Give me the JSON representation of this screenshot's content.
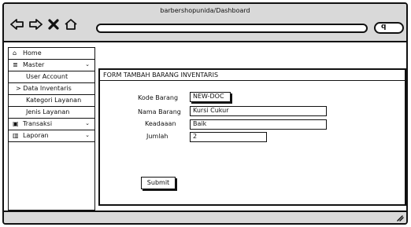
{
  "window": {
    "title": "barbershopunida/Dashboard",
    "url": ""
  },
  "colors": {
    "chrome": "#d9d9d9",
    "ink": "#111111",
    "surface": "#ffffff"
  },
  "browser": {
    "icons": [
      "back-arrow-icon",
      "forward-arrow-icon",
      "close-icon",
      "home-icon",
      "search-icon"
    ],
    "search_glyph": "q"
  },
  "sidebar": {
    "items": [
      {
        "label": "Home",
        "icon": "home-icon",
        "icon_glyph": "⌂"
      },
      {
        "label": "Master",
        "icon": "database-icon",
        "icon_glyph": "≣",
        "chevron": "⌄"
      },
      {
        "label": "User Account"
      },
      {
        "label": "Data Inventaris",
        "prefix": ">"
      },
      {
        "label": "Kategori Layanan"
      },
      {
        "label": "Jenis Layanan"
      },
      {
        "label": "Transaksi",
        "icon": "money-icon",
        "icon_glyph": "▣",
        "chevron": "⌄"
      },
      {
        "label": "Laporan",
        "icon": "chart-icon",
        "icon_glyph": "▥",
        "chevron": "⌄"
      }
    ]
  },
  "form": {
    "title": "FORM TAMBAH BARANG INVENTARIS",
    "fields": [
      {
        "label": "Kode Barang",
        "value": "NEW-DOC"
      },
      {
        "label": "Nama Barang",
        "value": "Kursi Cukur"
      },
      {
        "label": "Keadaaan",
        "value": "Baik"
      },
      {
        "label": "Jumlah",
        "value": "2"
      }
    ],
    "submit_label": "Submit"
  }
}
